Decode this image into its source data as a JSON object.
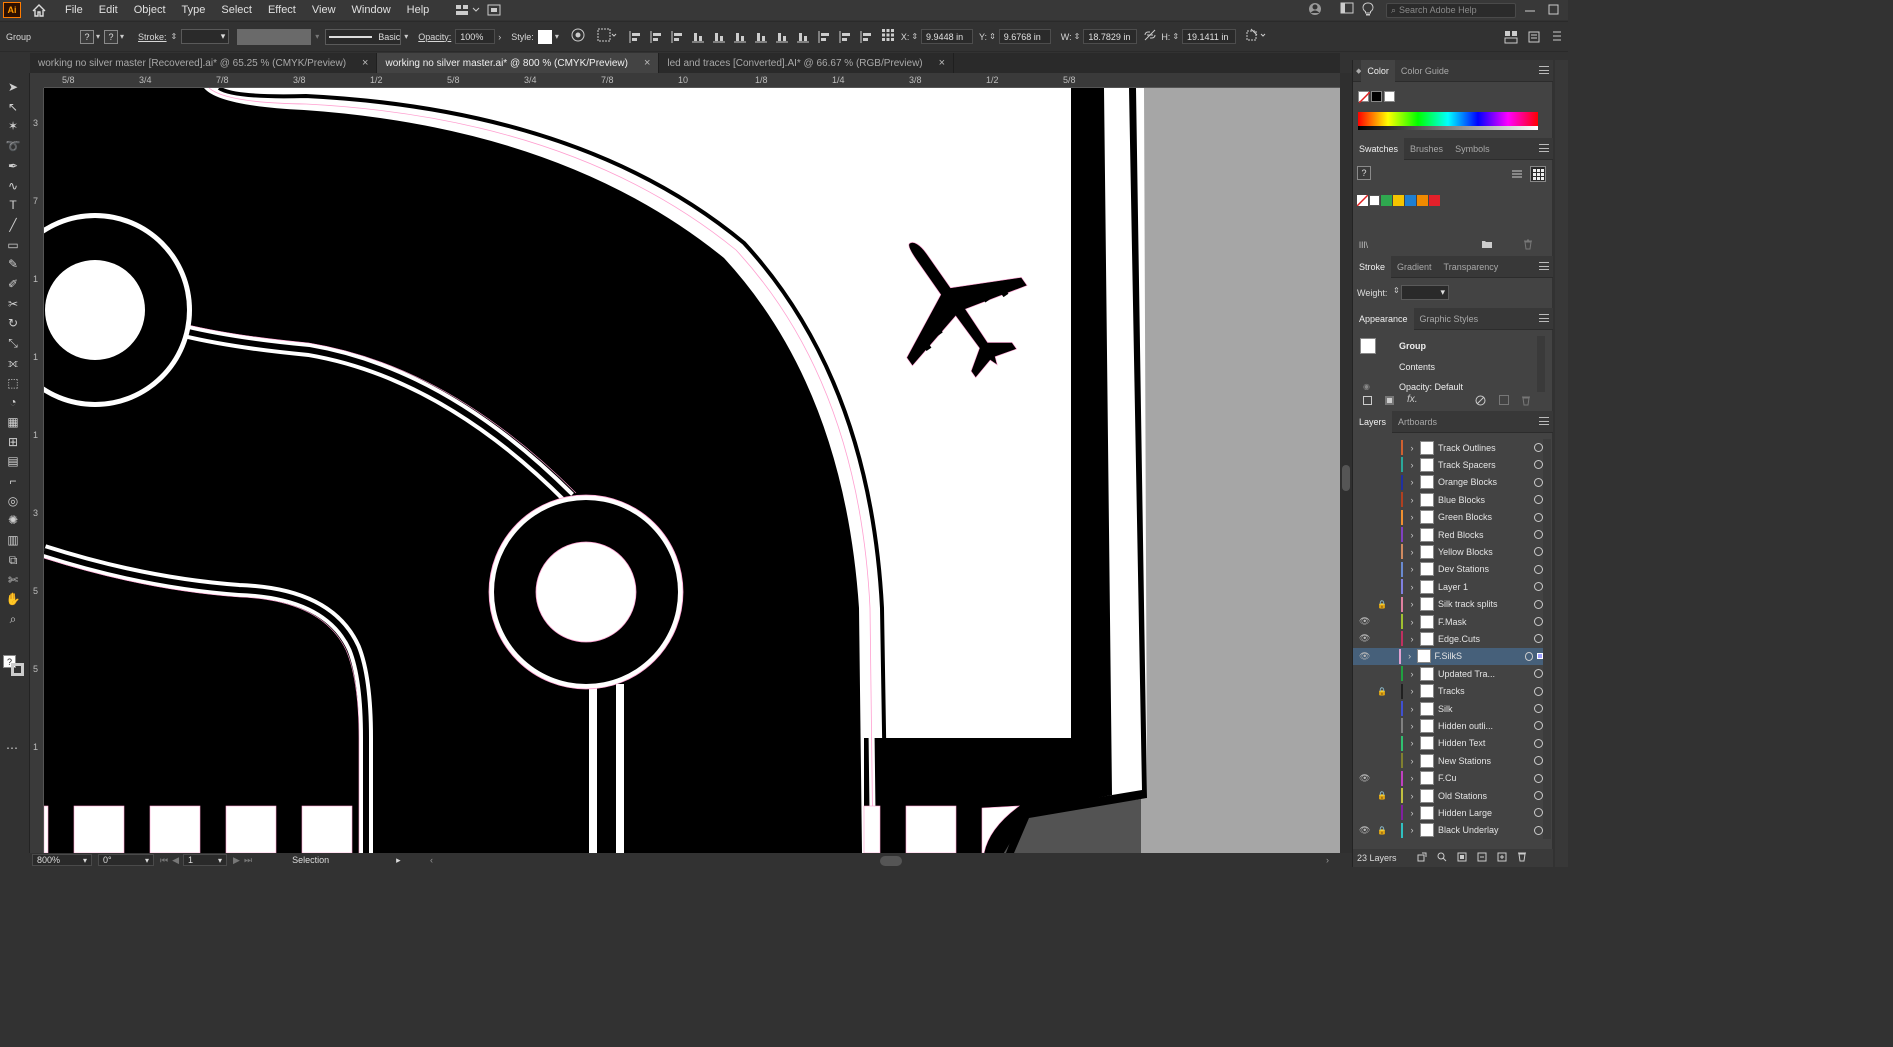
{
  "app": {
    "logo_text": "Ai",
    "menu": [
      "File",
      "Edit",
      "Object",
      "Type",
      "Select",
      "Effect",
      "View",
      "Window",
      "Help"
    ],
    "search_placeholder": "Search Adobe Help"
  },
  "control_bar": {
    "selection_type": "Group",
    "stroke_label": "Stroke:",
    "brush_label": "Basic",
    "opacity_label": "Opacity:",
    "opacity_value": "100%",
    "style_label": "Style:",
    "x_label": "X:",
    "x_value": "9.9448 in",
    "y_label": "Y:",
    "y_value": "9.6768 in",
    "w_label": "W:",
    "w_value": "18.7829 in",
    "h_label": "H:",
    "h_value": "19.1411 in",
    "unknown_fill": "?",
    "unknown_stroke": "?"
  },
  "tabs": [
    {
      "label": "working no silver master [Recovered].ai* @ 65.25 % (CMYK/Preview)",
      "active": false,
      "close": "×"
    },
    {
      "label": "working no silver master.ai* @ 800 % (CMYK/Preview)",
      "active": true,
      "close": "×"
    },
    {
      "label": "led and traces [Converted].AI* @ 66.67 % (RGB/Preview)",
      "active": false,
      "close": "×"
    }
  ],
  "ruler": {
    "h_labels": [
      "5/8",
      "3/4",
      "7/8",
      "3/8",
      "1/2",
      "5/8",
      "3/4",
      "7/8",
      "10",
      "1/8",
      "1/4",
      "3/8",
      "1/2",
      "5/8"
    ],
    "v_labels": [
      "3",
      "7",
      "1",
      "1",
      "1",
      "3",
      "5",
      "5",
      "1"
    ]
  },
  "status_bar": {
    "zoom": "800%",
    "rotation": "0°",
    "artboard": "1",
    "tool": "Selection"
  },
  "panels": {
    "color_tabs": [
      "Color",
      "Color Guide"
    ],
    "swatch_tabs": [
      "Swatches",
      "Brushes",
      "Symbols"
    ],
    "stroke_tabs": [
      "Stroke",
      "Gradient",
      "Transparency"
    ],
    "weight_label": "Weight:",
    "appearance_tabs": [
      "Appearance",
      "Graphic Styles"
    ],
    "appearance_group": "Group",
    "appearance_contents": "Contents",
    "appearance_opacity": "Opacity: Default",
    "fx_label": "fx.",
    "layers_tabs": [
      "Layers",
      "Artboards"
    ],
    "layers_count": "23 Layers",
    "swatch_colors": [
      "#2fa84f",
      "#f4c400",
      "#1f7fd1",
      "#f08a00",
      "#e3202a"
    ]
  },
  "layers": [
    {
      "name": "Track Outlines",
      "color": "#d06030",
      "visible": false,
      "locked": false,
      "selected": false
    },
    {
      "name": "Track Spacers",
      "color": "#2aa89a",
      "visible": false,
      "locked": false,
      "selected": false
    },
    {
      "name": "Orange Blocks",
      "color": "#2030a0",
      "visible": false,
      "locked": false,
      "selected": false
    },
    {
      "name": "Blue Blocks",
      "color": "#b04020",
      "visible": false,
      "locked": false,
      "selected": false
    },
    {
      "name": "Green Blocks",
      "color": "#f09030",
      "visible": false,
      "locked": false,
      "selected": false
    },
    {
      "name": "Red Blocks",
      "color": "#8040c0",
      "visible": false,
      "locked": false,
      "selected": false
    },
    {
      "name": "Yellow Blocks",
      "color": "#d08a60",
      "visible": false,
      "locked": false,
      "selected": false
    },
    {
      "name": "Dev Stations",
      "color": "#6a8ad0",
      "visible": false,
      "locked": false,
      "selected": false
    },
    {
      "name": "Layer 1",
      "color": "#8080e0",
      "visible": false,
      "locked": false,
      "selected": false
    },
    {
      "name": "Silk track splits",
      "color": "#e080a0",
      "visible": false,
      "locked": true,
      "selected": false
    },
    {
      "name": "F.Mask",
      "color": "#a0c030",
      "visible": true,
      "locked": false,
      "selected": false
    },
    {
      "name": "Edge.Cuts",
      "color": "#c03060",
      "visible": true,
      "locked": false,
      "selected": false
    },
    {
      "name": "F.SilkS",
      "color": "#e0a0d0",
      "visible": true,
      "locked": false,
      "selected": true
    },
    {
      "name": "Updated Tra...",
      "color": "#20a040",
      "visible": false,
      "locked": false,
      "selected": false
    },
    {
      "name": "Tracks",
      "color": "#202020",
      "visible": false,
      "locked": true,
      "selected": false
    },
    {
      "name": "Silk",
      "color": "#4050d0",
      "visible": false,
      "locked": false,
      "selected": false
    },
    {
      "name": "Hidden outli...",
      "color": "#808080",
      "visible": false,
      "locked": false,
      "selected": false
    },
    {
      "name": "Hidden Text",
      "color": "#30c070",
      "visible": false,
      "locked": false,
      "selected": false
    },
    {
      "name": "New Stations",
      "color": "#808030",
      "visible": false,
      "locked": false,
      "selected": false
    },
    {
      "name": "F.Cu",
      "color": "#c040c0",
      "visible": true,
      "locked": false,
      "selected": false
    },
    {
      "name": "Old Stations",
      "color": "#c0c040",
      "visible": false,
      "locked": true,
      "selected": false
    },
    {
      "name": "Hidden Large",
      "color": "#8020a0",
      "visible": false,
      "locked": false,
      "selected": false
    },
    {
      "name": "Black Underlay",
      "color": "#30c0c0",
      "visible": true,
      "locked": true,
      "selected": false
    }
  ]
}
